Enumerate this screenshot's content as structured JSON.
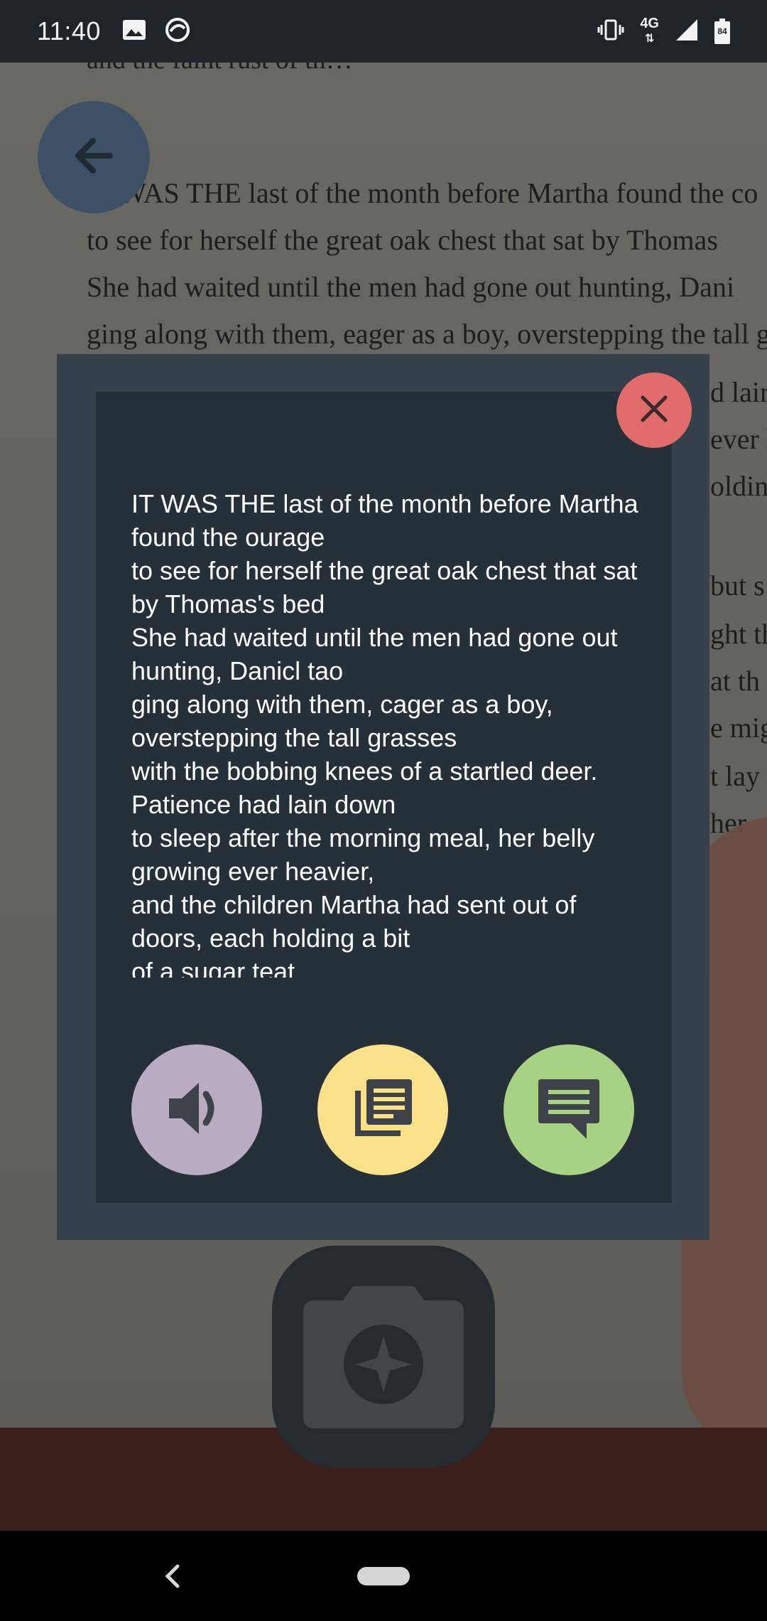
{
  "status_bar": {
    "time": "11:40",
    "network": "4G",
    "battery": "84",
    "icons": [
      "image-icon",
      "sync-icon",
      "vibrate-icon",
      "signal-icon",
      "battery-icon"
    ]
  },
  "background_page": {
    "top_line": "and the faint rust of th…",
    "lines": [
      "IT WAS THE last of the month before Martha found the co",
      "to see for herself the great oak chest that sat by Thomas",
      "She had waited until the men had gone out hunting, Dani",
      "ging along with them, eager as a boy, overstepping the tall g"
    ],
    "right_fragments": [
      "d lair",
      "ever h",
      "oldin",
      "but s",
      "ght th",
      "at th",
      "e mig",
      "t lay",
      "her"
    ]
  },
  "dialog": {
    "text": "IT WAS THE last of the month before Martha found the ourage\nto see for herself the great oak chest that sat by Thomas's bed\nShe had waited until the men had gone out hunting, Danicl tao\nging along with them, cager as a boy, overstepping the tall grasses\nwith the bobbing knees of a startled deer. Patience had lain down\nto sleep after the morning meal, her belly growing ever heavier,\nand the children Martha had sent out of doors, each holding a bit\nof a sugar teat",
    "buttons": {
      "close": "close-icon",
      "speak": "volume-icon",
      "read": "article-icon",
      "chat": "chat-icon"
    }
  },
  "colors": {
    "close": "#e06c6c",
    "speak": "#b8abc2",
    "read": "#fde08a",
    "chat": "#a8d283",
    "dialog_outer": "#37414b",
    "dialog_inner": "#263038"
  }
}
